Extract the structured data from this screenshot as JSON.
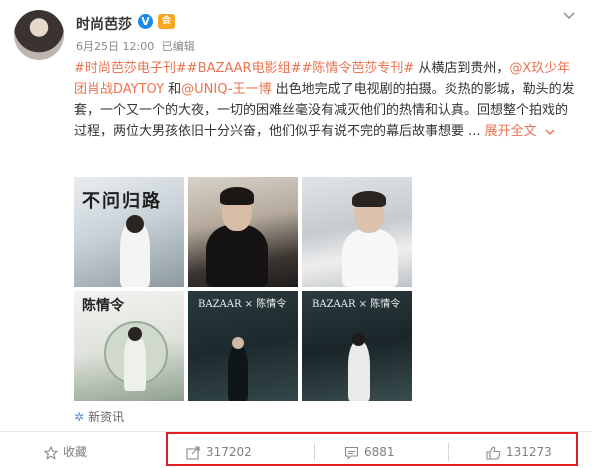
{
  "post": {
    "author": "时尚芭莎",
    "verified_badge": "V",
    "member_badge": "会",
    "date": "6月25日 12:00",
    "edited": "已编辑",
    "text": {
      "tags": "#时尚芭莎电子刊##BAZAAR电影组##陈情令芭莎专刊#",
      "part1": " 从横店到贵州，",
      "mention1": "@X玖少年团肖战DAYTOY",
      "part2": " 和",
      "mention2": "@UNIQ-王一博",
      "part3": " 出色地完成了电视剧的拍摄。炎热的影城，勒头的发套，一个又一个的大夜，一切的困难丝毫没有减灭他们的热情和认真。回想整个拍戏的过程，两位大男孩依旧十分兴奋，他们似乎有说不完的幕后故事想要 ... ",
      "expand": "展开全文",
      "expand_icon": "chevron-down-icon"
    },
    "images": [
      {
        "overlay": "不问归路"
      },
      {
        "overlay": ""
      },
      {
        "overlay": ""
      },
      {
        "overlay": "陈情令"
      },
      {
        "overlay": "BAZAAR × 陈情令"
      },
      {
        "overlay": "BAZAAR × 陈情令"
      }
    ],
    "source": "新资讯"
  },
  "actions": {
    "favorite": "收藏",
    "repost": "317202",
    "comment": "6881",
    "like": "131273"
  },
  "colors": {
    "link": "#eb7350",
    "highlight_box": "#e02020",
    "verified": "#1a8ae8"
  }
}
